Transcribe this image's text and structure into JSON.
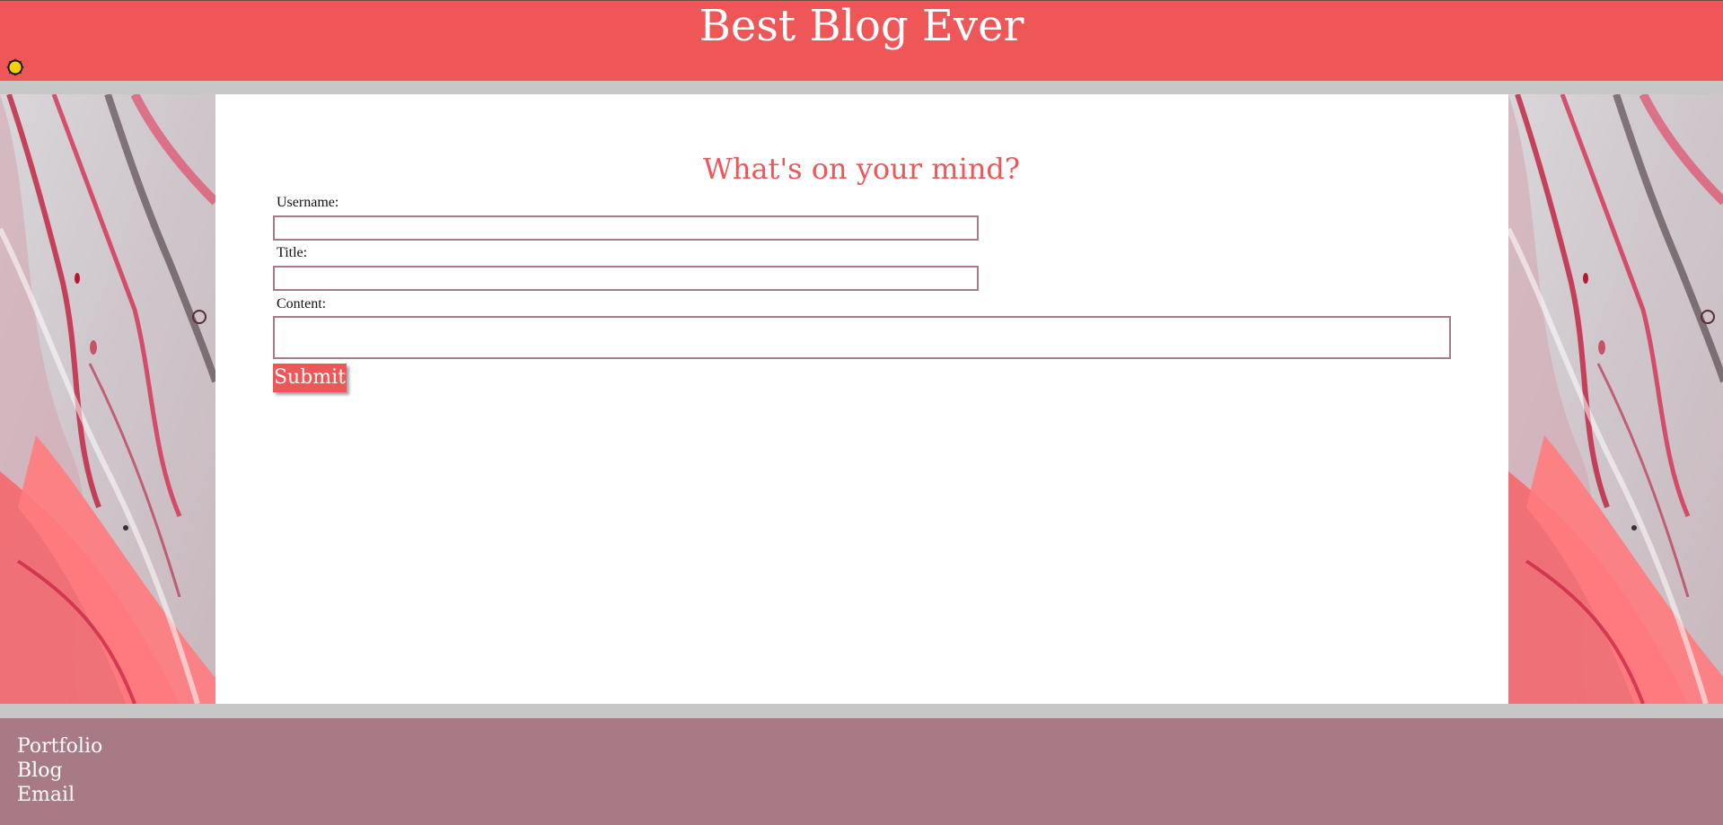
{
  "header": {
    "title": "Best Blog Ever",
    "mode_toggle_icon": "sun-icon"
  },
  "form": {
    "heading": "What's on your mind?",
    "username_label": "Username:",
    "username_value": "",
    "title_label": "Title:",
    "title_value": "",
    "content_label": "Content:",
    "content_value": "",
    "submit_label": "Submit"
  },
  "footer": {
    "links": [
      "Portfolio",
      "Blog",
      "Email"
    ]
  },
  "colors": {
    "header_bg": "#ef5658",
    "accent": "#ef5658",
    "footer_bg": "#a87a86",
    "input_border": "#a67b88",
    "page_bg": "#c7c7c7"
  }
}
